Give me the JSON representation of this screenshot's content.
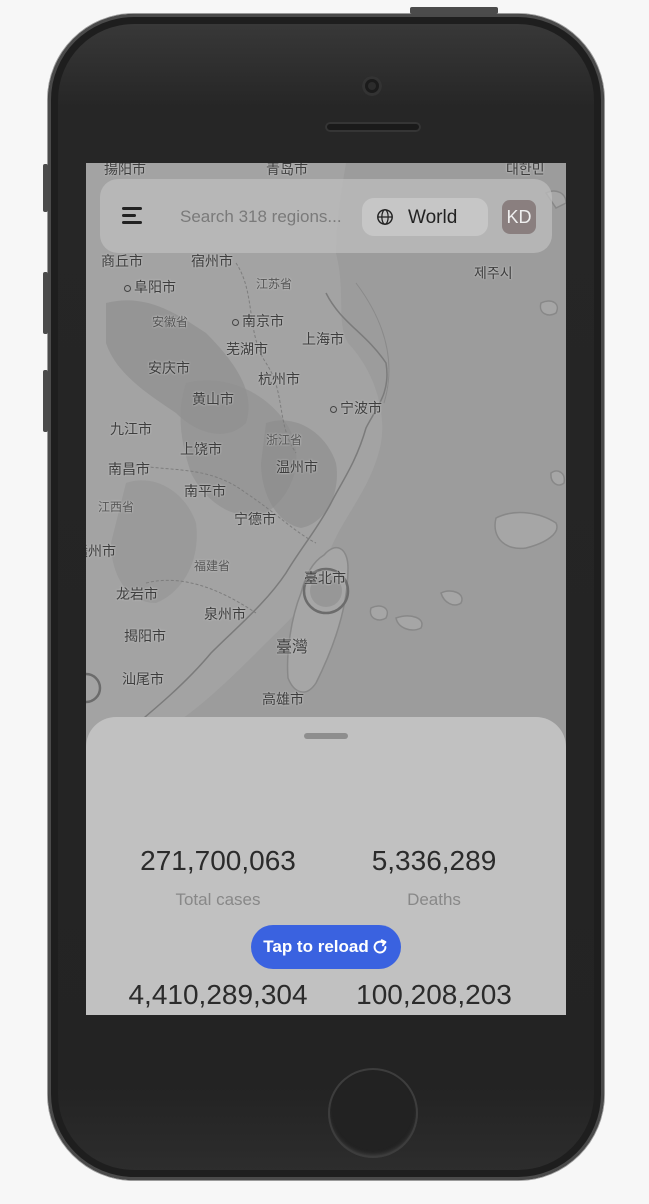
{
  "search": {
    "placeholder": "Search 318 regions..."
  },
  "header": {
    "region_label": "World",
    "avatar_initials": "KD"
  },
  "map": {
    "labels": [
      {
        "text": "揚阳市"
      },
      {
        "text": "青岛市"
      },
      {
        "text": "대한민"
      },
      {
        "text": "商丘市"
      },
      {
        "text": "宿州市"
      },
      {
        "text": "제주시"
      },
      {
        "text": "阜阳市"
      },
      {
        "text": "江苏省"
      },
      {
        "text": "安徽省"
      },
      {
        "text": "南京市"
      },
      {
        "text": "芜湖市"
      },
      {
        "text": "上海市"
      },
      {
        "text": "安庆市"
      },
      {
        "text": "杭州市"
      },
      {
        "text": "黄山市"
      },
      {
        "text": "宁波市"
      },
      {
        "text": "九江市"
      },
      {
        "text": "浙江省"
      },
      {
        "text": "上饶市"
      },
      {
        "text": "南昌市"
      },
      {
        "text": "温州市"
      },
      {
        "text": "江西省"
      },
      {
        "text": "南平市"
      },
      {
        "text": "宁德市"
      },
      {
        "text": "赣州市"
      },
      {
        "text": "福建省"
      },
      {
        "text": "臺北市"
      },
      {
        "text": "龙岩市"
      },
      {
        "text": "泉州市"
      },
      {
        "text": "揭阳市"
      },
      {
        "text": "臺灣"
      },
      {
        "text": "汕尾市"
      },
      {
        "text": "高雄市"
      }
    ]
  },
  "stats": {
    "total_cases": {
      "value": "271,700,063",
      "label": "Total cases"
    },
    "deaths": {
      "value": "5,336,289",
      "label": "Deaths"
    },
    "third": {
      "value": "4,410,289,304"
    },
    "fourth": {
      "value": "100,208,203"
    }
  },
  "reload": {
    "label": "Tap to reload"
  },
  "colors": {
    "accent": "#3a62e0",
    "avatar": "#8a7f7f",
    "sheet": "#c1c1c1"
  }
}
